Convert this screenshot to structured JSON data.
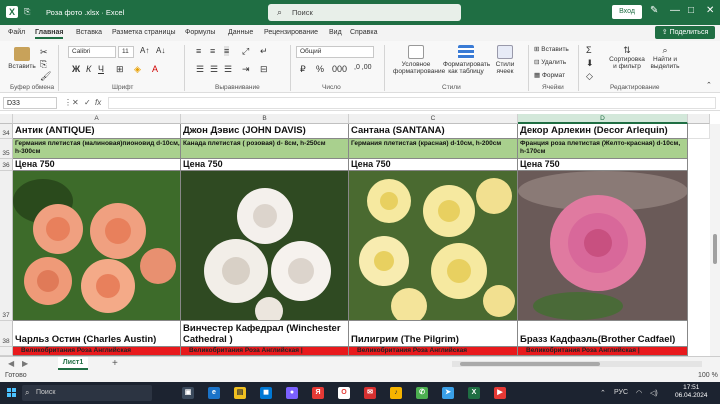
{
  "titlebar": {
    "title": "Роза фото .xlsx  ·  Excel",
    "search_placeholder": "Поиск",
    "signin": "Вход",
    "minimize": "—",
    "restore": "□",
    "close": "✕"
  },
  "menu": {
    "tabs": [
      "Файл",
      "Главная",
      "Вставка",
      "Разметка страницы",
      "Формулы",
      "Данные",
      "Рецензирование",
      "Вид",
      "Справка"
    ],
    "share": "Поделиться"
  },
  "ribbon": {
    "paste": "Вставить",
    "clipboard": "Буфер обмена",
    "font_name": "Calibri",
    "font_size": "11",
    "font": "Шрифт",
    "alignment": "Выравнивание",
    "number_format": "Общий",
    "number": "Число",
    "conditional": "Условное форматирование",
    "format_table": "Форматировать как таблицу",
    "cell_styles": "Стили ячеек",
    "styles": "Стили",
    "insert": "Вставить",
    "delete": "Удалить",
    "format": "Формат",
    "cells": "Ячейки",
    "sort_filter": "Сортировка и фильтр",
    "find_select": "Найти и выделить",
    "editing": "Редактирование"
  },
  "formula_bar": {
    "name_box": "D33",
    "fx": "fx",
    "value": ""
  },
  "columns": [
    "A",
    "B",
    "C",
    "D"
  ],
  "selected_column": "D",
  "rows": {
    "r34": {
      "num": "34",
      "cells": [
        "Антик (ANTIQUE)",
        "Джон Дэвис (JOHN DAVIS)",
        "Сантана (SANTANA)",
        "Декор Арлекин (Decor Arlequin)"
      ]
    },
    "r35": {
      "num": "35",
      "cells": [
        "Германия плетистая (малиновая)пионовид d-10см, h-300см",
        "Канада плетистая ( розовая) d- 8см, h-250см",
        "Германия плетистая (красная) d-10см, h-200см",
        "Франция роза плетистая (Желто-красная) d-10см, h-170см"
      ]
    },
    "r36": {
      "num": "36",
      "cells": [
        "Цена 750",
        "Цена 750",
        "Цена 750",
        "Цена 750"
      ]
    },
    "r37": {
      "num": "37"
    },
    "r38": {
      "num": "38",
      "cells": [
        "Чарльз Остин (Charles Austin)",
        "Винчестер Кафедрал (Winchester Cathedral )",
        "Пилигрим (The Pilgrim)",
        "Бразз Кадфаэль(Brother Cadfael)"
      ]
    },
    "r39": {
      "cells": [
        "Великобритания Роза Английская",
        "Великобритания Роза Английская |",
        "Великобритания Роза Английская",
        "Великобритания Роза Английская |"
      ]
    }
  },
  "photos": [
    {
      "name": "rose-peach-photo",
      "petal": "#f0a080",
      "core": "#e8805c",
      "bg": "#3d6b2a"
    },
    {
      "name": "rose-white-photo",
      "petal": "#f4f0ec",
      "core": "#dcd4cc",
      "bg": "#2f4a22"
    },
    {
      "name": "rose-yellow-photo",
      "petal": "#f6e9a0",
      "core": "#e8d060",
      "bg": "#4a6a30"
    },
    {
      "name": "rose-pink-photo",
      "petal": "#e07aa0",
      "core": "#c85080",
      "bg": "#6a5a58"
    }
  ],
  "sheet": {
    "tab": "Лист1",
    "add": "+"
  },
  "status": {
    "ready": "Готово",
    "zoom": "100 %"
  },
  "taskbar": {
    "search": "Поиск",
    "lang": "РУС",
    "time": "17:51",
    "date": "06.04.2024"
  },
  "colors": {
    "excel_green": "#1f6e43",
    "header_green": "#a9d08e",
    "red_row": "#e8191c"
  }
}
